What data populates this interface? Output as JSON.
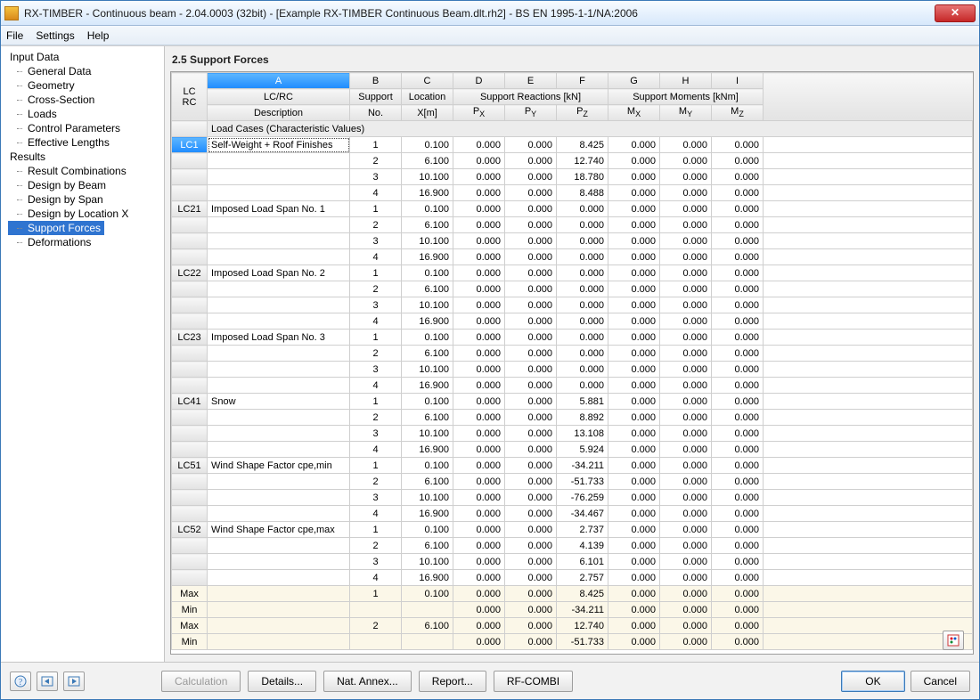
{
  "window": {
    "title": "RX-TIMBER - Continuous beam - 2.04.0003 (32bit) - [Example RX-TIMBER Continuous Beam.dlt.rh2] - BS EN 1995-1-1/NA:2006"
  },
  "menu": {
    "file": "File",
    "settings": "Settings",
    "help": "Help"
  },
  "tree": {
    "input": "Input Data",
    "input_items": [
      "General Data",
      "Geometry",
      "Cross-Section",
      "Loads",
      "Control Parameters",
      "Effective Lengths"
    ],
    "results": "Results",
    "results_items": [
      "Result Combinations",
      "Design by Beam",
      "Design by Span",
      "Design by Location X",
      "Support Forces",
      "Deformations"
    ],
    "selected": "Support Forces"
  },
  "panel": {
    "title": "2.5 Support Forces"
  },
  "columns": {
    "letters": [
      "A",
      "B",
      "C",
      "D",
      "E",
      "F",
      "G",
      "H",
      "I"
    ],
    "lcrc1": "LC",
    "lcrc2": "RC",
    "lcrc_desc1": "LC/RC",
    "lcrc_desc2": "Description",
    "support1": "Support",
    "support2": "No.",
    "loc1": "Location",
    "loc2": "X[m]",
    "react_group": "Support Reactions [kN]",
    "mom_group": "Support Moments [kNm]",
    "px": "P",
    "py": "P",
    "pz": "P",
    "mx": "M",
    "my": "M",
    "mz": "M",
    "px_s": "X",
    "py_s": "Y",
    "pz_s": "Z",
    "mx_s": "X",
    "my_s": "Y",
    "mz_s": "Z"
  },
  "group_label": "Load Cases (Characteristic Values)",
  "rows": [
    {
      "lc": "LC1",
      "desc": "Self-Weight + Roof Finishes",
      "sup": "1",
      "x": "0.100",
      "px": "0.000",
      "py": "0.000",
      "pz": "8.425",
      "mx": "0.000",
      "my": "0.000",
      "mz": "0.000",
      "sel": true,
      "first": true
    },
    {
      "lc": "",
      "desc": "",
      "sup": "2",
      "x": "6.100",
      "px": "0.000",
      "py": "0.000",
      "pz": "12.740",
      "mx": "0.000",
      "my": "0.000",
      "mz": "0.000"
    },
    {
      "lc": "",
      "desc": "",
      "sup": "3",
      "x": "10.100",
      "px": "0.000",
      "py": "0.000",
      "pz": "18.780",
      "mx": "0.000",
      "my": "0.000",
      "mz": "0.000"
    },
    {
      "lc": "",
      "desc": "",
      "sup": "4",
      "x": "16.900",
      "px": "0.000",
      "py": "0.000",
      "pz": "8.488",
      "mx": "0.000",
      "my": "0.000",
      "mz": "0.000"
    },
    {
      "lc": "LC21",
      "desc": "Imposed Load Span No. 1",
      "sup": "1",
      "x": "0.100",
      "px": "0.000",
      "py": "0.000",
      "pz": "0.000",
      "mx": "0.000",
      "my": "0.000",
      "mz": "0.000"
    },
    {
      "lc": "",
      "desc": "",
      "sup": "2",
      "x": "6.100",
      "px": "0.000",
      "py": "0.000",
      "pz": "0.000",
      "mx": "0.000",
      "my": "0.000",
      "mz": "0.000"
    },
    {
      "lc": "",
      "desc": "",
      "sup": "3",
      "x": "10.100",
      "px": "0.000",
      "py": "0.000",
      "pz": "0.000",
      "mx": "0.000",
      "my": "0.000",
      "mz": "0.000"
    },
    {
      "lc": "",
      "desc": "",
      "sup": "4",
      "x": "16.900",
      "px": "0.000",
      "py": "0.000",
      "pz": "0.000",
      "mx": "0.000",
      "my": "0.000",
      "mz": "0.000"
    },
    {
      "lc": "LC22",
      "desc": "Imposed Load Span No. 2",
      "sup": "1",
      "x": "0.100",
      "px": "0.000",
      "py": "0.000",
      "pz": "0.000",
      "mx": "0.000",
      "my": "0.000",
      "mz": "0.000"
    },
    {
      "lc": "",
      "desc": "",
      "sup": "2",
      "x": "6.100",
      "px": "0.000",
      "py": "0.000",
      "pz": "0.000",
      "mx": "0.000",
      "my": "0.000",
      "mz": "0.000"
    },
    {
      "lc": "",
      "desc": "",
      "sup": "3",
      "x": "10.100",
      "px": "0.000",
      "py": "0.000",
      "pz": "0.000",
      "mx": "0.000",
      "my": "0.000",
      "mz": "0.000"
    },
    {
      "lc": "",
      "desc": "",
      "sup": "4",
      "x": "16.900",
      "px": "0.000",
      "py": "0.000",
      "pz": "0.000",
      "mx": "0.000",
      "my": "0.000",
      "mz": "0.000"
    },
    {
      "lc": "LC23",
      "desc": "Imposed Load Span No. 3",
      "sup": "1",
      "x": "0.100",
      "px": "0.000",
      "py": "0.000",
      "pz": "0.000",
      "mx": "0.000",
      "my": "0.000",
      "mz": "0.000"
    },
    {
      "lc": "",
      "desc": "",
      "sup": "2",
      "x": "6.100",
      "px": "0.000",
      "py": "0.000",
      "pz": "0.000",
      "mx": "0.000",
      "my": "0.000",
      "mz": "0.000"
    },
    {
      "lc": "",
      "desc": "",
      "sup": "3",
      "x": "10.100",
      "px": "0.000",
      "py": "0.000",
      "pz": "0.000",
      "mx": "0.000",
      "my": "0.000",
      "mz": "0.000"
    },
    {
      "lc": "",
      "desc": "",
      "sup": "4",
      "x": "16.900",
      "px": "0.000",
      "py": "0.000",
      "pz": "0.000",
      "mx": "0.000",
      "my": "0.000",
      "mz": "0.000"
    },
    {
      "lc": "LC41",
      "desc": "Snow",
      "sup": "1",
      "x": "0.100",
      "px": "0.000",
      "py": "0.000",
      "pz": "5.881",
      "mx": "0.000",
      "my": "0.000",
      "mz": "0.000"
    },
    {
      "lc": "",
      "desc": "",
      "sup": "2",
      "x": "6.100",
      "px": "0.000",
      "py": "0.000",
      "pz": "8.892",
      "mx": "0.000",
      "my": "0.000",
      "mz": "0.000"
    },
    {
      "lc": "",
      "desc": "",
      "sup": "3",
      "x": "10.100",
      "px": "0.000",
      "py": "0.000",
      "pz": "13.108",
      "mx": "0.000",
      "my": "0.000",
      "mz": "0.000"
    },
    {
      "lc": "",
      "desc": "",
      "sup": "4",
      "x": "16.900",
      "px": "0.000",
      "py": "0.000",
      "pz": "5.924",
      "mx": "0.000",
      "my": "0.000",
      "mz": "0.000"
    },
    {
      "lc": "LC51",
      "desc": "Wind Shape Factor cpe,min",
      "sup": "1",
      "x": "0.100",
      "px": "0.000",
      "py": "0.000",
      "pz": "-34.211",
      "mx": "0.000",
      "my": "0.000",
      "mz": "0.000"
    },
    {
      "lc": "",
      "desc": "",
      "sup": "2",
      "x": "6.100",
      "px": "0.000",
      "py": "0.000",
      "pz": "-51.733",
      "mx": "0.000",
      "my": "0.000",
      "mz": "0.000"
    },
    {
      "lc": "",
      "desc": "",
      "sup": "3",
      "x": "10.100",
      "px": "0.000",
      "py": "0.000",
      "pz": "-76.259",
      "mx": "0.000",
      "my": "0.000",
      "mz": "0.000"
    },
    {
      "lc": "",
      "desc": "",
      "sup": "4",
      "x": "16.900",
      "px": "0.000",
      "py": "0.000",
      "pz": "-34.467",
      "mx": "0.000",
      "my": "0.000",
      "mz": "0.000"
    },
    {
      "lc": "LC52",
      "desc": "Wind Shape Factor cpe,max",
      "sup": "1",
      "x": "0.100",
      "px": "0.000",
      "py": "0.000",
      "pz": "2.737",
      "mx": "0.000",
      "my": "0.000",
      "mz": "0.000"
    },
    {
      "lc": "",
      "desc": "",
      "sup": "2",
      "x": "6.100",
      "px": "0.000",
      "py": "0.000",
      "pz": "4.139",
      "mx": "0.000",
      "my": "0.000",
      "mz": "0.000"
    },
    {
      "lc": "",
      "desc": "",
      "sup": "3",
      "x": "10.100",
      "px": "0.000",
      "py": "0.000",
      "pz": "6.101",
      "mx": "0.000",
      "my": "0.000",
      "mz": "0.000"
    },
    {
      "lc": "",
      "desc": "",
      "sup": "4",
      "x": "16.900",
      "px": "0.000",
      "py": "0.000",
      "pz": "2.757",
      "mx": "0.000",
      "my": "0.000",
      "mz": "0.000"
    }
  ],
  "summary": [
    {
      "lc": "Max",
      "sup": "1",
      "x": "0.100",
      "px": "0.000",
      "py": "0.000",
      "pz": "8.425",
      "mx": "0.000",
      "my": "0.000",
      "mz": "0.000"
    },
    {
      "lc": "Min",
      "sup": "",
      "x": "",
      "px": "0.000",
      "py": "0.000",
      "pz": "-34.211",
      "mx": "0.000",
      "my": "0.000",
      "mz": "0.000"
    },
    {
      "lc": "Max",
      "sup": "2",
      "x": "6.100",
      "px": "0.000",
      "py": "0.000",
      "pz": "12.740",
      "mx": "0.000",
      "my": "0.000",
      "mz": "0.000"
    },
    {
      "lc": "Min",
      "sup": "",
      "x": "",
      "px": "0.000",
      "py": "0.000",
      "pz": "-51.733",
      "mx": "0.000",
      "my": "0.000",
      "mz": "0.000"
    }
  ],
  "buttons": {
    "calculation": "Calculation",
    "details": "Details...",
    "natannex": "Nat. Annex...",
    "report": "Report...",
    "rfcombi": "RF-COMBI",
    "ok": "OK",
    "cancel": "Cancel",
    "close": "✕"
  }
}
